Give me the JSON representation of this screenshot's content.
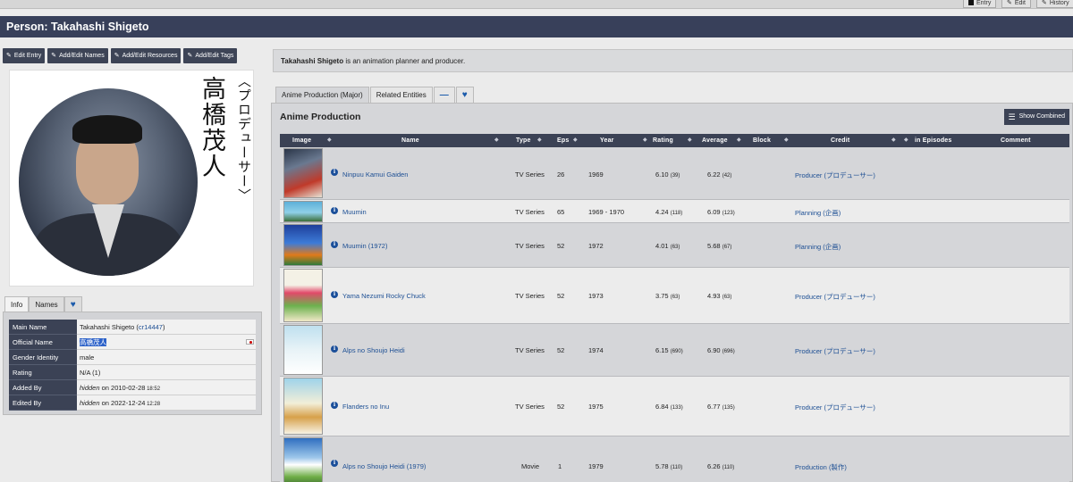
{
  "top_tabs": [
    {
      "label": "Entry",
      "icon": "square-icon"
    },
    {
      "label": "Edit",
      "icon": "pencil-icon"
    },
    {
      "label": "History",
      "icon": "pencil-icon"
    }
  ],
  "title": "Person: Takahashi Shigeto",
  "left_buttons": [
    "Edit Entry",
    "Add/Edit Names",
    "Add/Edit Resources",
    "Add/Edit Tags"
  ],
  "photo": {
    "name_jp": "高橋茂人",
    "role_jp": "〈プロデューサー〉"
  },
  "info_tabs": [
    "Info",
    "Names"
  ],
  "info": [
    {
      "label": "Main Name",
      "value": "Takahashi Shigeto (",
      "link": "cr14447",
      "suffix": ")"
    },
    {
      "label": "Official Name",
      "value": "高橋茂人"
    },
    {
      "label": "Gender Identity",
      "value": "male"
    },
    {
      "label": "Rating",
      "value": "N/A (1)"
    },
    {
      "label": "Added By",
      "user": "hidden",
      "on": " on 2010-02-28",
      "time": " 18:52"
    },
    {
      "label": "Edited By",
      "user": "hidden",
      "on": " on 2022-12-24",
      "time": " 12:28"
    }
  ],
  "description": {
    "name": "Takahashi Shigeto",
    "text": " is an animation planner and producer."
  },
  "right_tabs": [
    "Anime Production (Major)",
    "Related Entities"
  ],
  "production": {
    "heading": "Anime Production",
    "show_combined": "Show Combined",
    "columns": [
      "Image",
      "Name",
      "Type",
      "Eps",
      "Year",
      "Rating",
      "Average",
      "Block",
      "Credit",
      "in Episodes",
      "Comment"
    ],
    "rows": [
      {
        "name": "Ninpuu Kamui Gaiden",
        "type": "TV Series",
        "eps": "26",
        "year": "1969",
        "rating": "6.10",
        "rating_n": "(39)",
        "avg": "6.22",
        "avg_n": "(42)",
        "credit": "Producer (プロデューサー)"
      },
      {
        "name": "Muumin",
        "type": "TV Series",
        "eps": "65",
        "year": "1969 - 1970",
        "rating": "4.24",
        "rating_n": "(118)",
        "avg": "6.09",
        "avg_n": "(123)",
        "credit": "Planning (企画)"
      },
      {
        "name": "Muumin (1972)",
        "type": "TV Series",
        "eps": "52",
        "year": "1972",
        "rating": "4.01",
        "rating_n": "(63)",
        "avg": "5.68",
        "avg_n": "(67)",
        "credit": "Planning (企画)"
      },
      {
        "name": "Yama Nezumi Rocky Chuck",
        "type": "TV Series",
        "eps": "52",
        "year": "1973",
        "rating": "3.75",
        "rating_n": "(63)",
        "avg": "4.93",
        "avg_n": "(63)",
        "credit": "Producer (プロデューサー)"
      },
      {
        "name": "Alps no Shoujo Heidi",
        "type": "TV Series",
        "eps": "52",
        "year": "1974",
        "rating": "6.15",
        "rating_n": "(690)",
        "avg": "6.90",
        "avg_n": "(696)",
        "credit": "Producer (プロデューサー)"
      },
      {
        "name": "Flanders no Inu",
        "type": "TV Series",
        "eps": "52",
        "year": "1975",
        "rating": "6.84",
        "rating_n": "(133)",
        "avg": "6.77",
        "avg_n": "(135)",
        "credit": "Producer (プロデューサー)"
      },
      {
        "name": "Alps no Shoujo Heidi (1979)",
        "type": "Movie",
        "eps": "1",
        "year": "1979",
        "rating": "5.78",
        "rating_n": "(110)",
        "avg": "6.26",
        "avg_n": "(110)",
        "credit": "Production (製作)"
      }
    ]
  },
  "colors": {
    "header": "#38405a",
    "dark": "#3b4255",
    "link": "#1d4f94",
    "panel": "#d5d6d9"
  }
}
